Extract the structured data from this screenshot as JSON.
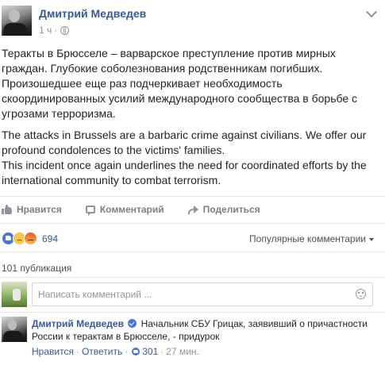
{
  "post": {
    "author": "Дмитрий Медведев",
    "time": "1 ч",
    "dot": "·",
    "paragraph_ru": "Теракты в Брюсселе – варварское преступление против мирных граждан. Глубокие соболезнования родственникам погибших. Произошедшее еще раз подчеркивает необходимость скоординированных усилий международного сообщества в борьбе с угрозами терроризма.",
    "paragraph_en_1": "The attacks in Brussels are a barbaric crime against civilians. We offer our profound condolences to the victims' families.",
    "paragraph_en_2": "This incident once again underlines the need for coordinated efforts by the international community to combat terrorism."
  },
  "actions": {
    "like": "Нравится",
    "comment": "Комментарий",
    "share": "Поделиться"
  },
  "reactions": {
    "count": "694",
    "sort_label": "Популярные комментарии"
  },
  "shares": "101 публикация",
  "composer": {
    "placeholder": "Написать комментарий ..."
  },
  "comment": {
    "author": "Дмитрий Медведев",
    "text": "Начальник СБУ Грицак, заявивший о причастности России к терактам в Брюсселе, - придурок",
    "like": "Нравится",
    "dot": "·",
    "reply": "Ответить",
    "likes": "301",
    "time": "27 мин."
  },
  "colors": {
    "link": "#365899",
    "muted": "#90949c",
    "text": "#1d2129"
  }
}
